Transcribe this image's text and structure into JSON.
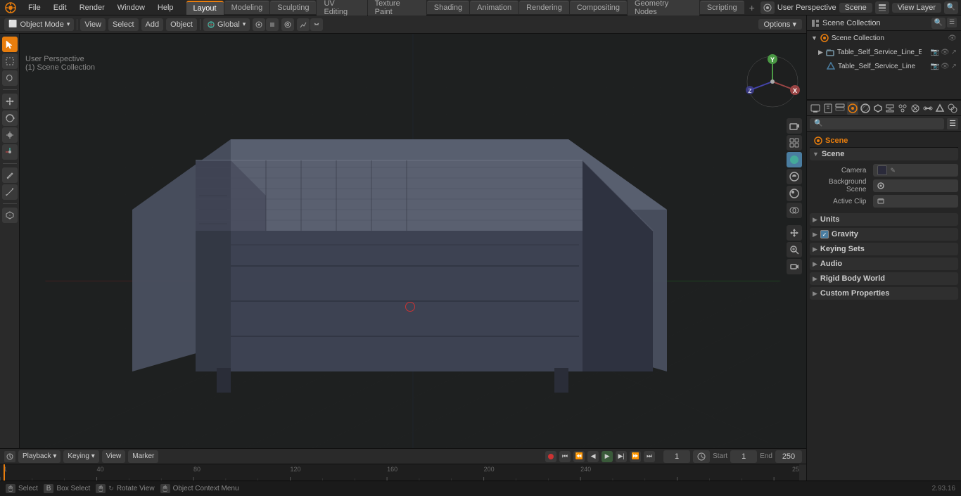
{
  "app": {
    "title": "Blender",
    "version": "2.93.16"
  },
  "top_menu": {
    "items": [
      "File",
      "Edit",
      "Render",
      "Window",
      "Help"
    ]
  },
  "workspace_tabs": {
    "tabs": [
      "Layout",
      "Modeling",
      "Sculpting",
      "UV Editing",
      "Texture Paint",
      "Shading",
      "Animation",
      "Rendering",
      "Compositing",
      "Geometry Nodes",
      "Scripting"
    ],
    "active": "Layout"
  },
  "header": {
    "options_label": "Options ▾",
    "mode_label": "Object Mode",
    "view_label": "View",
    "select_label": "Select",
    "add_label": "Add",
    "object_label": "Object"
  },
  "viewport": {
    "view_name": "User Perspective",
    "scene_collection": "(1) Scene Collection",
    "transform": "Global"
  },
  "outliner": {
    "title": "Scene Collection",
    "items": [
      {
        "name": "Table_Self_Service_Line_Elem",
        "indent": 1,
        "has_child": true,
        "icon": "mesh"
      },
      {
        "name": "Table_Self_Service_Line_",
        "indent": 2,
        "has_child": false,
        "icon": "mesh"
      }
    ]
  },
  "properties": {
    "search_placeholder": "🔍",
    "active_tab": "scene",
    "header_label": "Scene",
    "scene_label": "Scene",
    "sections": {
      "scene": {
        "label": "Scene",
        "expanded": true,
        "fields": {
          "camera_label": "Camera",
          "background_scene_label": "Background Scene",
          "active_clip_label": "Active Clip"
        }
      },
      "units": {
        "label": "Units",
        "expanded": false
      },
      "gravity": {
        "label": "Gravity",
        "expanded": false,
        "checked": true
      },
      "keying_sets": {
        "label": "Keying Sets",
        "expanded": false
      },
      "audio": {
        "label": "Audio",
        "expanded": false
      },
      "rigid_body_world": {
        "label": "Rigid Body World",
        "expanded": false
      },
      "custom_properties": {
        "label": "Custom Properties",
        "expanded": false
      }
    },
    "tabs": [
      {
        "icon": "🎬",
        "name": "render",
        "title": "Render"
      },
      {
        "icon": "📤",
        "name": "output",
        "title": "Output"
      },
      {
        "icon": "🌈",
        "name": "view-layer",
        "title": "View Layer"
      },
      {
        "icon": "🌐",
        "name": "scene",
        "title": "Scene",
        "active": true
      },
      {
        "icon": "🌍",
        "name": "world",
        "title": "World"
      },
      {
        "icon": "📦",
        "name": "object",
        "title": "Object"
      },
      {
        "icon": "⚙️",
        "name": "modifiers",
        "title": "Modifiers"
      },
      {
        "icon": "💎",
        "name": "particles",
        "title": "Particles"
      },
      {
        "icon": "🔧",
        "name": "physics",
        "title": "Physics"
      },
      {
        "icon": "🔗",
        "name": "constraints",
        "title": "Constraints"
      },
      {
        "icon": "🟦",
        "name": "data",
        "title": "Object Data"
      },
      {
        "icon": "🎨",
        "name": "material",
        "title": "Material"
      }
    ]
  },
  "timeline": {
    "playback_label": "Playback ▾",
    "keying_label": "Keying ▾",
    "view_label": "View",
    "marker_label": "Marker",
    "current_frame": "1",
    "start_label": "Start",
    "start_value": "1",
    "end_label": "End",
    "end_value": "250",
    "frame_numbers": [
      "1",
      "40",
      "80",
      "120",
      "160",
      "200",
      "240"
    ]
  },
  "status_bar": {
    "select_label": "Select",
    "box_select_label": "Box Select",
    "rotate_view_label": "Rotate View",
    "object_context_menu_label": "Object Context Menu",
    "version": "2.93.16"
  },
  "axis_labels": {
    "x": "X",
    "y": "Y",
    "z": "Z"
  },
  "collection": {
    "label": "Collection"
  }
}
